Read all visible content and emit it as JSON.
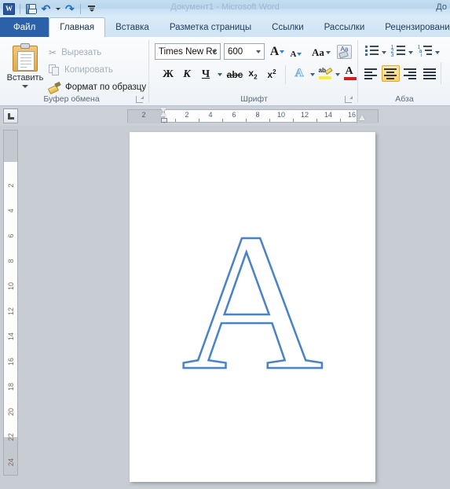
{
  "window": {
    "title_visible": "Документ1 - Microsoft Word",
    "title_right_fragment": "До"
  },
  "quick_access": {
    "app_logo": "word-logo",
    "items": [
      {
        "name": "save",
        "icon": "floppy-icon"
      },
      {
        "name": "undo",
        "icon": "undo-arrow-icon"
      },
      {
        "name": "redo",
        "icon": "redo-arrow-icon"
      },
      {
        "name": "customize",
        "icon": "customize-qat-icon"
      }
    ]
  },
  "tabs": [
    {
      "label": "Файл",
      "type": "file"
    },
    {
      "label": "Главная",
      "type": "active"
    },
    {
      "label": "Вставка",
      "type": "normal"
    },
    {
      "label": "Разметка страницы",
      "type": "normal"
    },
    {
      "label": "Ссылки",
      "type": "normal"
    },
    {
      "label": "Рассылки",
      "type": "normal"
    },
    {
      "label": "Рецензирование",
      "type": "normal"
    }
  ],
  "ribbon": {
    "clipboard": {
      "group_label": "Буфер обмена",
      "paste_label": "Вставить",
      "cut_label": "Вырезать",
      "copy_label": "Копировать",
      "format_painter_label": "Формат по образцу"
    },
    "font": {
      "group_label": "Шрифт",
      "font_name": "Times New Rc",
      "font_size": "600",
      "bold_label": "Ж",
      "italic_label": "К",
      "underline_label": "Ч",
      "strikethrough_label": "abc",
      "subscript_label": "x",
      "subscript_index": "2",
      "superscript_label": "x",
      "superscript_index": "2",
      "grow_font_label": "A",
      "shrink_font_label": "A",
      "change_case_label": "Aa",
      "clear_format_label": "Aa",
      "text_effect_label": "A",
      "highlight_label": "ab",
      "font_color_label": "A",
      "highlight_color": "#ffec3d",
      "font_color": "#d01e1e"
    },
    "paragraph": {
      "group_label": "Абза",
      "bullets_icon": "bulleted-list-icon",
      "numbering_icon": "numbered-list-icon",
      "multilevel_icon": "multilevel-list-icon",
      "align_left_icon": "align-left-icon",
      "align_center_icon": "align-center-icon",
      "align_right_icon": "align-right-icon",
      "align_justify_icon": "align-justify-icon",
      "active_alignment": "align-center",
      "active_highlight_color": "#ffd26b"
    }
  },
  "rulers": {
    "tab_selector_icon": "left-tab-stop-icon",
    "horizontal_numbers": [
      "2",
      "2",
      "4",
      "6",
      "8",
      "10",
      "12",
      "14",
      "16"
    ],
    "vertical_numbers": [
      "2",
      "4",
      "6",
      "8",
      "10",
      "12",
      "14",
      "16",
      "18",
      "20",
      "22",
      "24"
    ]
  },
  "document": {
    "content_character": "A",
    "outline_color": "#4a82c4",
    "fill_color": "#ffffff"
  }
}
